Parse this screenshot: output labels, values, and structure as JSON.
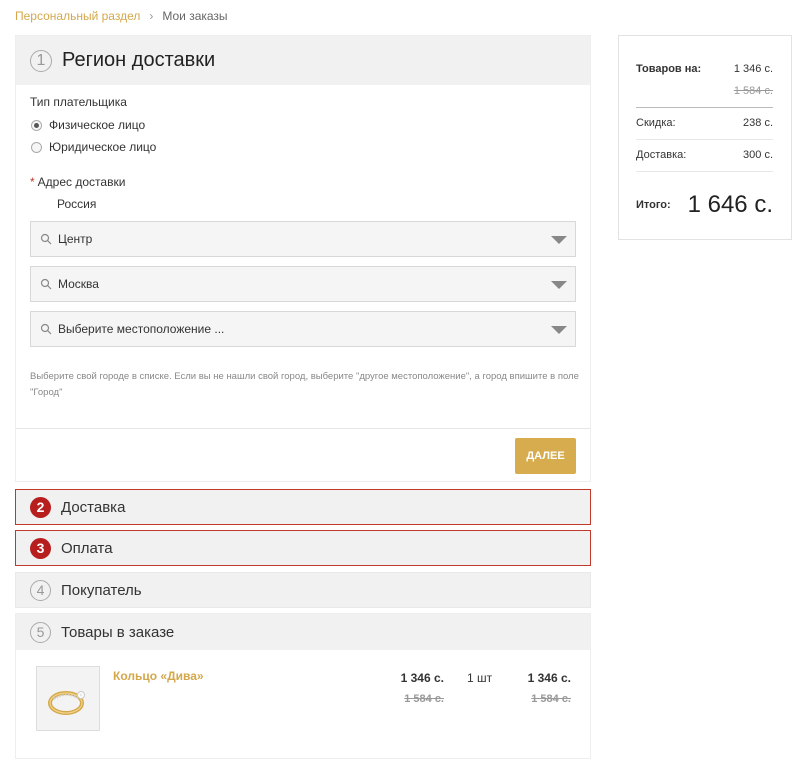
{
  "breadcrumb": {
    "items": [
      "Персональный раздел",
      "Мои заказы"
    ],
    "separator": "›"
  },
  "region_section": {
    "number": "1",
    "title": "Регион доставки",
    "payer_type_label": "Тип плательщика",
    "payer_options": [
      {
        "label": "Физическое лицо",
        "checked": true
      },
      {
        "label": "Юридическое лицо",
        "checked": false
      }
    ],
    "address_required_mark": "*",
    "address_label": "Адрес доставки",
    "country": "Россия",
    "location_selects": [
      "Центр",
      "Москва",
      "Выберите местоположение ..."
    ],
    "hint": "Выберите свой городе в списке. Если вы не нашли свой город, выберите \"другое местоположение\", а город впишите в поле \"Город\"",
    "next_button": "ДАЛЕЕ"
  },
  "sections": [
    {
      "number": "2",
      "title": "Доставка",
      "state": "error"
    },
    {
      "number": "3",
      "title": "Оплата",
      "state": "error"
    },
    {
      "number": "4",
      "title": "Покупатель",
      "state": "inactive"
    }
  ],
  "order_items_section": {
    "number": "5",
    "title": "Товары в заказе",
    "items": [
      {
        "name": "Кольцо «Дива»",
        "price": "1 346 с.",
        "old_price": "1 584 с.",
        "quantity": "1 шт",
        "sum": "1 346 с.",
        "old_sum": "1 584 с."
      }
    ]
  },
  "summary": {
    "goods_label": "Товаров на:",
    "goods_value": "1 346 с.",
    "goods_old_value": "1 584 с.",
    "discount_label": "Скидка:",
    "discount_value": "238 с.",
    "delivery_label": "Доставка:",
    "delivery_value": "300 с.",
    "total_label": "Итого:",
    "total_value": "1 646 с."
  },
  "colors": {
    "accent": "#d6ac4f",
    "error": "#b71f1f",
    "header_bg": "#f1f1f1"
  }
}
